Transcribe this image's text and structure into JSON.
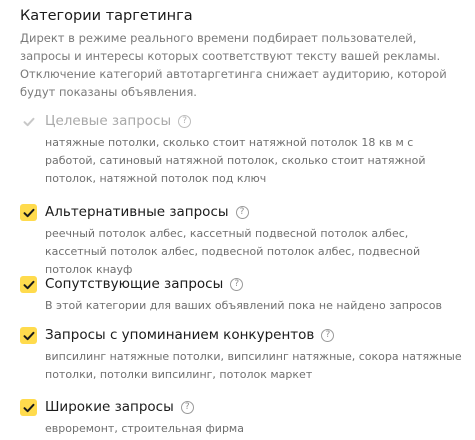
{
  "section": {
    "title": "Категории таргетинга",
    "description": "Директ в режиме реального времени подбирает пользователей, запросы и интересы которых соответствуют тексту вашей рекламы. Отключение категорий автотаргетинга снижает аудиторию, которой будут показаны объявления."
  },
  "categories": [
    {
      "title": "Целевые запросы",
      "queries": "натяжные потолки, сколько стоит натяжной потолок 18 кв м с работой, сатиновый натяжной потолок, сколько стоит натяжной потолок, натяжной потолок под ключ",
      "checked": true,
      "disabled": true
    },
    {
      "title": "Альтернативные запросы",
      "queries": "реечный потолок албес, кассетный подвесной потолок албес, кассетный потолок албес, подвесной потолок албес, подвесной потолок кнауф",
      "checked": true,
      "disabled": false
    },
    {
      "title": "Сопутствующие запросы",
      "queries": "В этой категории для ваших объявлений пока не найдено запросов",
      "checked": true,
      "disabled": false
    },
    {
      "title": "Запросы с упоминанием конкурентов",
      "queries": "випсилинг натяжные потолки, випсилинг натяжные, сокора натяжные потолки, потолки випсилинг, потолок маркет",
      "checked": true,
      "disabled": false
    },
    {
      "title": "Широкие запросы",
      "queries": "евроремонт, строительная фирма",
      "checked": true,
      "disabled": false
    }
  ],
  "icons": {
    "help": "question-circle-icon",
    "check": "check-icon"
  },
  "colors": {
    "checkbox_checked": "#ffdb4d",
    "checkmark": "#1b1b1b",
    "checkmark_disabled": "#c8c8c8",
    "muted_text": "#7a7a7a"
  }
}
